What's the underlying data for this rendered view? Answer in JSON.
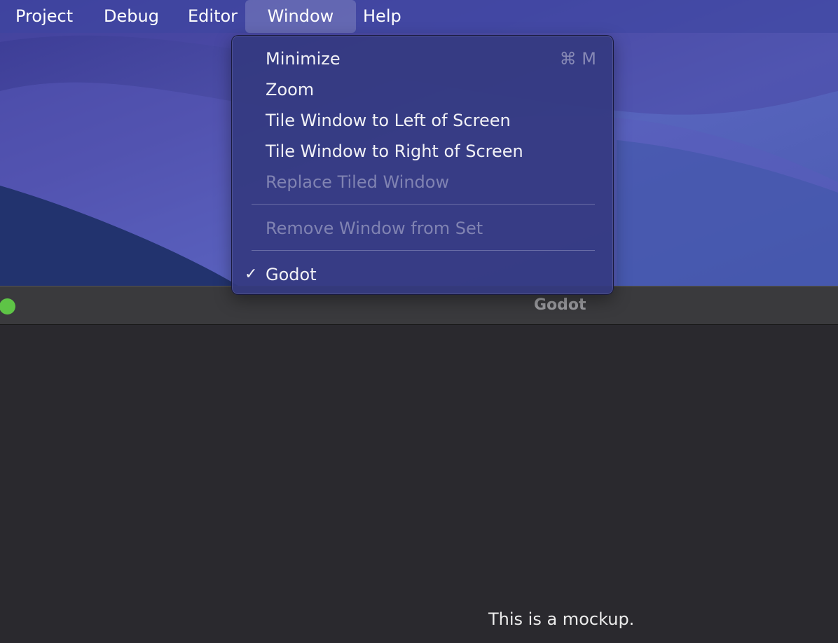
{
  "menubar": {
    "items": [
      "Project",
      "Debug",
      "Editor",
      "Window",
      "Help"
    ],
    "active": "Window"
  },
  "window_menu": {
    "items": [
      {
        "label": "Minimize",
        "shortcut": "⌘ M",
        "enabled": true
      },
      {
        "label": "Zoom",
        "enabled": true
      },
      {
        "label": "Tile Window to Left of Screen",
        "enabled": true
      },
      {
        "label": "Tile Window to Right of Screen",
        "enabled": true
      },
      {
        "label": "Replace Tiled Window",
        "enabled": false
      },
      {
        "label": "Remove Window from Set",
        "enabled": false
      },
      {
        "label": "Godot",
        "checked": true,
        "check_glyph": "✓",
        "enabled": true
      }
    ]
  },
  "app_window": {
    "title": "Godot",
    "note": "This is a mockup."
  },
  "colors": {
    "traffic_green": "#5ec446",
    "menu_bg": "#343a80",
    "window_bg": "#2a292e"
  },
  "icons": {
    "shortcut": "command-key-icon",
    "check": "checkmark-icon"
  }
}
